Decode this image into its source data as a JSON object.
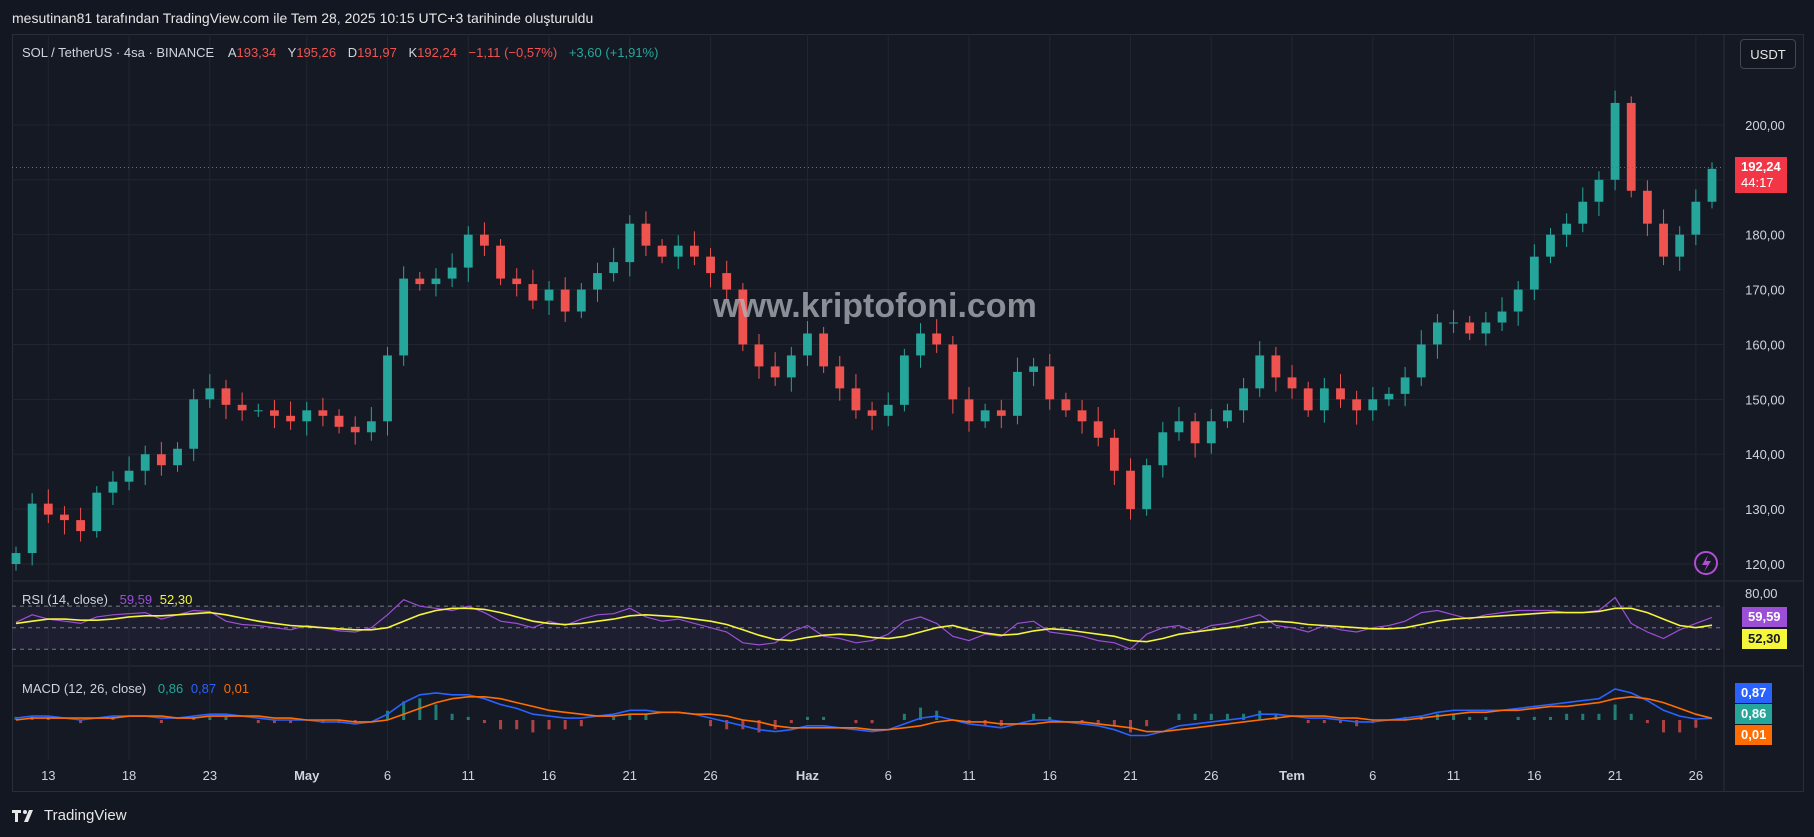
{
  "header": {
    "caption": "mesutinan81 tarafından TradingView.com ile Tem 28, 2025 10:15 UTC+3 tarihinde oluşturuldu"
  },
  "symbol": {
    "name": "SOL / TetherUS · 4sa · BINANCE",
    "open_label": "A",
    "open": "193,34",
    "high_label": "Y",
    "high": "195,26",
    "low_label": "D",
    "low": "191,97",
    "close_label": "K",
    "close": "192,24",
    "change": "−1,11 (−0,57%)",
    "change2": "+3,60 (+1,91%)"
  },
  "currency_button": "USDT",
  "watermark": "www.kriptofoni.com",
  "price_tag": {
    "price": "192,24",
    "countdown": "44:17"
  },
  "rsi": {
    "label": "RSI (14, close)",
    "value": "59,59",
    "ma": "52,30",
    "level": "80,00"
  },
  "macd": {
    "label": "MACD (12, 26, close)",
    "v1": "0,86",
    "v2": "0,87",
    "v3": "0,01"
  },
  "tags_right": {
    "macd_blue": "0,87",
    "macd_green": "0,86",
    "macd_orange": "0,01"
  },
  "brand": "TradingView",
  "colors": {
    "up": "#26a69a",
    "down": "#ef5350",
    "rsi": "#9c4fd6",
    "rsi_ma": "#f5f53a",
    "macd": "#2962ff",
    "signal": "#ff6d00",
    "price_tag": "#f23645"
  },
  "chart_data": [
    {
      "type": "candlestick",
      "title": "SOL / TetherUS · 4sa · BINANCE",
      "ylim": [
        118,
        210
      ],
      "y_ticks": [
        "200,00",
        "190,00",
        "180,00",
        "170,00",
        "160,00",
        "150,00",
        "140,00",
        "130,00",
        "120,00"
      ],
      "y_tick_values": [
        200,
        190,
        180,
        170,
        160,
        150,
        140,
        130,
        120
      ],
      "x_ticks": [
        "13",
        "18",
        "23",
        "May",
        "6",
        "11",
        "16",
        "21",
        "26",
        "Haz",
        "6",
        "11",
        "16",
        "21",
        "26",
        "Tem",
        "6",
        "11",
        "16",
        "21",
        "26"
      ],
      "x_tick_index": [
        2,
        7,
        12,
        18,
        23,
        28,
        33,
        38,
        43,
        49,
        54,
        59,
        64,
        69,
        74,
        79,
        84,
        89,
        94,
        99,
        104
      ],
      "last_price": 192.24,
      "close": [
        122,
        131,
        129,
        128,
        126,
        133,
        135,
        137,
        140,
        138,
        141,
        150,
        152,
        149,
        148,
        148,
        147,
        146,
        148,
        147,
        145,
        144,
        146,
        158,
        172,
        171,
        172,
        174,
        180,
        178,
        172,
        171,
        168,
        170,
        166,
        170,
        173,
        175,
        182,
        178,
        176,
        178,
        176,
        173,
        170,
        160,
        156,
        154,
        158,
        162,
        156,
        152,
        148,
        147,
        149,
        158,
        162,
        160,
        150,
        146,
        148,
        147,
        155,
        156,
        150,
        148,
        146,
        143,
        137,
        130,
        138,
        144,
        146,
        142,
        146,
        148,
        152,
        158,
        154,
        152,
        148,
        152,
        150,
        148,
        150,
        151,
        154,
        160,
        164,
        164,
        162,
        164,
        166,
        170,
        176,
        180,
        182,
        186,
        190,
        204,
        188,
        182,
        176,
        180,
        186,
        192
      ]
    },
    {
      "type": "line",
      "title": "RSI (14, close)",
      "ylim": [
        20,
        85
      ],
      "levels": [
        70,
        50,
        30
      ],
      "y_ticks": [
        "80,00"
      ],
      "series": [
        {
          "name": "RSI",
          "values": [
            55,
            62,
            58,
            56,
            54,
            60,
            62,
            63,
            64,
            58,
            62,
            66,
            65,
            56,
            53,
            52,
            50,
            48,
            52,
            50,
            47,
            46,
            50,
            62,
            76,
            70,
            68,
            66,
            70,
            64,
            56,
            54,
            50,
            56,
            52,
            58,
            62,
            63,
            68,
            60,
            56,
            58,
            54,
            50,
            46,
            36,
            34,
            36,
            46,
            52,
            42,
            40,
            36,
            38,
            44,
            56,
            60,
            54,
            42,
            38,
            44,
            42,
            54,
            56,
            46,
            44,
            42,
            38,
            36,
            30,
            44,
            50,
            52,
            46,
            52,
            54,
            58,
            62,
            52,
            50,
            46,
            52,
            48,
            46,
            50,
            52,
            56,
            64,
            66,
            62,
            58,
            62,
            64,
            66,
            66,
            66,
            64,
            64,
            66,
            78,
            54,
            46,
            40,
            48,
            54,
            59.59
          ]
        },
        {
          "name": "RSI-based MA",
          "values": [
            54,
            56,
            58,
            58,
            57,
            57,
            58,
            60,
            61,
            61,
            62,
            63,
            64,
            62,
            59,
            56,
            54,
            52,
            51,
            50,
            49,
            48,
            48,
            50,
            56,
            62,
            66,
            68,
            68,
            67,
            64,
            60,
            56,
            54,
            53,
            54,
            56,
            58,
            61,
            62,
            61,
            60,
            58,
            56,
            53,
            48,
            43,
            39,
            38,
            41,
            43,
            44,
            43,
            41,
            40,
            42,
            46,
            50,
            52,
            48,
            45,
            43,
            44,
            47,
            49,
            48,
            46,
            44,
            42,
            38,
            37,
            40,
            44,
            46,
            48,
            50,
            52,
            55,
            56,
            55,
            53,
            52,
            51,
            50,
            49,
            49,
            50,
            53,
            56,
            58,
            59,
            60,
            61,
            62,
            63,
            64,
            64,
            64,
            65,
            68,
            68,
            64,
            58,
            52,
            50,
            52.3
          ]
        }
      ]
    },
    {
      "type": "line",
      "title": "MACD (12, 26, close)",
      "series": [
        {
          "name": "MACD",
          "values": [
            1,
            2,
            2,
            1,
            0,
            1,
            2,
            2,
            2,
            1,
            1,
            2,
            3,
            3,
            2,
            1,
            0,
            0,
            0,
            -1,
            -1,
            -2,
            -1,
            3,
            9,
            13,
            14,
            13,
            13,
            11,
            8,
            6,
            3,
            2,
            1,
            1,
            2,
            3,
            5,
            5,
            4,
            4,
            3,
            1,
            -1,
            -3,
            -5,
            -6,
            -5,
            -3,
            -3,
            -4,
            -5,
            -6,
            -5,
            -2,
            1,
            2,
            0,
            -2,
            -3,
            -4,
            -2,
            0,
            0,
            -1,
            -2,
            -3,
            -5,
            -8,
            -8,
            -6,
            -3,
            -2,
            -1,
            0,
            1,
            3,
            3,
            2,
            1,
            1,
            0,
            -1,
            -1,
            0,
            1,
            2,
            4,
            5,
            5,
            5,
            5,
            6,
            7,
            8,
            9,
            10,
            11,
            16,
            14,
            10,
            5,
            2,
            0.5,
            0.87
          ]
        },
        {
          "name": "Signal",
          "values": [
            0,
            1,
            1,
            1,
            1,
            1,
            1,
            2,
            2,
            2,
            1,
            1,
            2,
            2,
            2,
            2,
            1,
            1,
            0,
            0,
            0,
            -1,
            -1,
            0,
            3,
            6,
            9,
            11,
            12,
            12,
            11,
            9,
            7,
            5,
            4,
            3,
            2,
            2,
            3,
            3,
            4,
            4,
            3,
            3,
            2,
            0,
            -1,
            -3,
            -4,
            -4,
            -4,
            -4,
            -4,
            -5,
            -5,
            -4,
            -3,
            -1,
            0,
            -1,
            -1,
            -2,
            -2,
            -2,
            -1,
            -1,
            -1,
            -2,
            -3,
            -4,
            -6,
            -6,
            -5,
            -4,
            -3,
            -2,
            -1,
            0,
            1,
            2,
            2,
            2,
            1,
            1,
            0,
            0,
            0,
            1,
            2,
            3,
            4,
            4,
            5,
            5,
            6,
            7,
            7,
            8,
            9,
            11,
            12,
            11,
            9,
            6,
            3,
            0.86
          ]
        }
      ]
    }
  ]
}
